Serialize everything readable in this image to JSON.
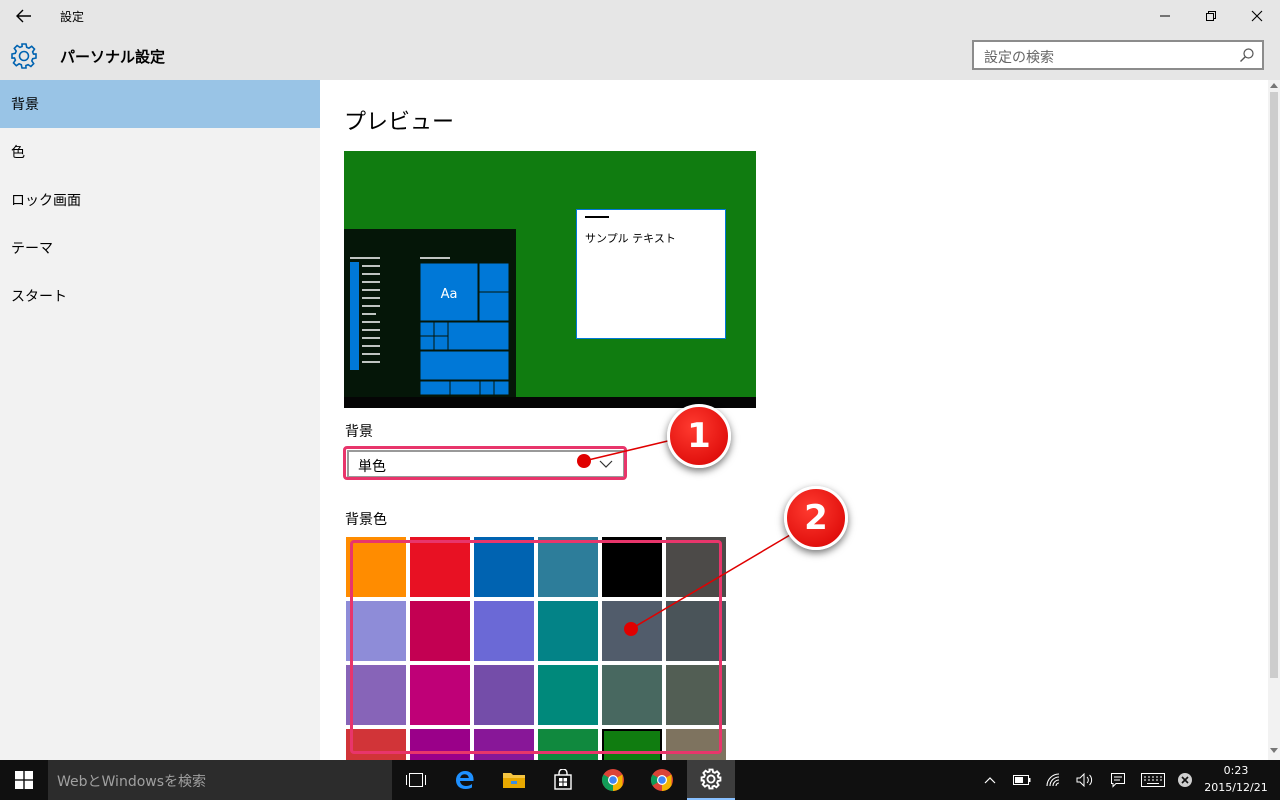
{
  "window": {
    "title": "設定",
    "back_label": "←",
    "controls": {
      "minimize": "–",
      "maximize": "❐",
      "close": "✕"
    }
  },
  "header": {
    "page_title": "パーソナル設定",
    "search_placeholder": "設定の検索",
    "icon": "gear-icon"
  },
  "sidebar": {
    "items": [
      {
        "label": "背景",
        "selected": true
      },
      {
        "label": "色"
      },
      {
        "label": "ロック画面"
      },
      {
        "label": "テーマ"
      },
      {
        "label": "スタート"
      }
    ]
  },
  "content": {
    "preview_heading": "プレビュー",
    "preview_sample_text": "サンプル テキスト",
    "preview_tile_text": "Aa",
    "background_label": "背景",
    "background_value": "単色",
    "background_color_label": "背景色",
    "swatch_colors": [
      "#ff8c00",
      "#e81123",
      "#0063b1",
      "#2d7d9a",
      "#000000",
      "#4c4a48",
      "#8e8cd8",
      "#c30052",
      "#6b69d6",
      "#038387",
      "#515c6b",
      "#4a5459",
      "#8764b8",
      "#bf0077",
      "#744da9",
      "#00897b",
      "#486860",
      "#525e54",
      "#d13438",
      "#9a0089",
      "#881798",
      "#10893e",
      "#107c10",
      "#7e735f"
    ],
    "selected_swatch_index": 22,
    "selected_color": "#107c10"
  },
  "annotations": {
    "callout_1": "1",
    "callout_2": "2",
    "accent": "#e8356b"
  },
  "taskbar": {
    "search_placeholder": "WebとWindowsを検索",
    "apps": [
      "task-view-icon",
      "edge-icon",
      "file-explorer-icon",
      "store-icon",
      "chrome-icon",
      "chrome-icon",
      "settings-gear-icon"
    ],
    "clock_time": "0:23",
    "clock_date": "2015/12/21"
  }
}
